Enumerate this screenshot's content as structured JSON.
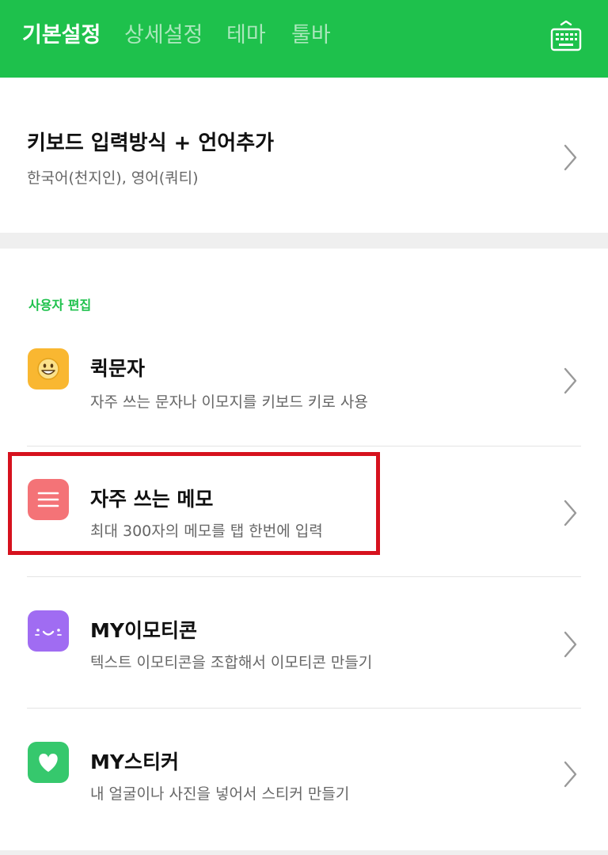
{
  "header": {
    "tabs": [
      {
        "label": "기본설정",
        "active": true
      },
      {
        "label": "상세설정",
        "active": false
      },
      {
        "label": "테마",
        "active": false
      },
      {
        "label": "툴바",
        "active": false
      }
    ],
    "keyboard_icon": "keyboard-icon",
    "background_color": "#1ec14c"
  },
  "keyboard_input": {
    "title": "키보드 입력방식 + 언어추가",
    "subtitle": "한국어(천지인), 영어(쿼티)"
  },
  "user_edit": {
    "section_title": "사용자 편집",
    "items": [
      {
        "title": "퀵문자",
        "subtitle": "자주 쓰는 문자나 이모지를 키보드 키로 사용",
        "icon": "smiley-emoji-icon",
        "icon_color": "#f9b731"
      },
      {
        "title": "자주 쓰는 메모",
        "subtitle": "최대 300자의 메모를 탭 한번에 입력",
        "icon": "memo-lines-icon",
        "icon_color": "#f47377",
        "highlighted": true
      },
      {
        "title": "MY이모티콘",
        "subtitle": "텍스트 이모티콘을 조합해서 이모티콘 만들기",
        "icon": "emoticon-face-icon",
        "icon_color": "#a06cf2"
      },
      {
        "title": "MY스티커",
        "subtitle": "내 얼굴이나 사진을 넣어서 스티커 만들기",
        "icon": "heart-icon",
        "icon_color": "#36c86d"
      }
    ]
  },
  "highlight_color": "#d6121e"
}
